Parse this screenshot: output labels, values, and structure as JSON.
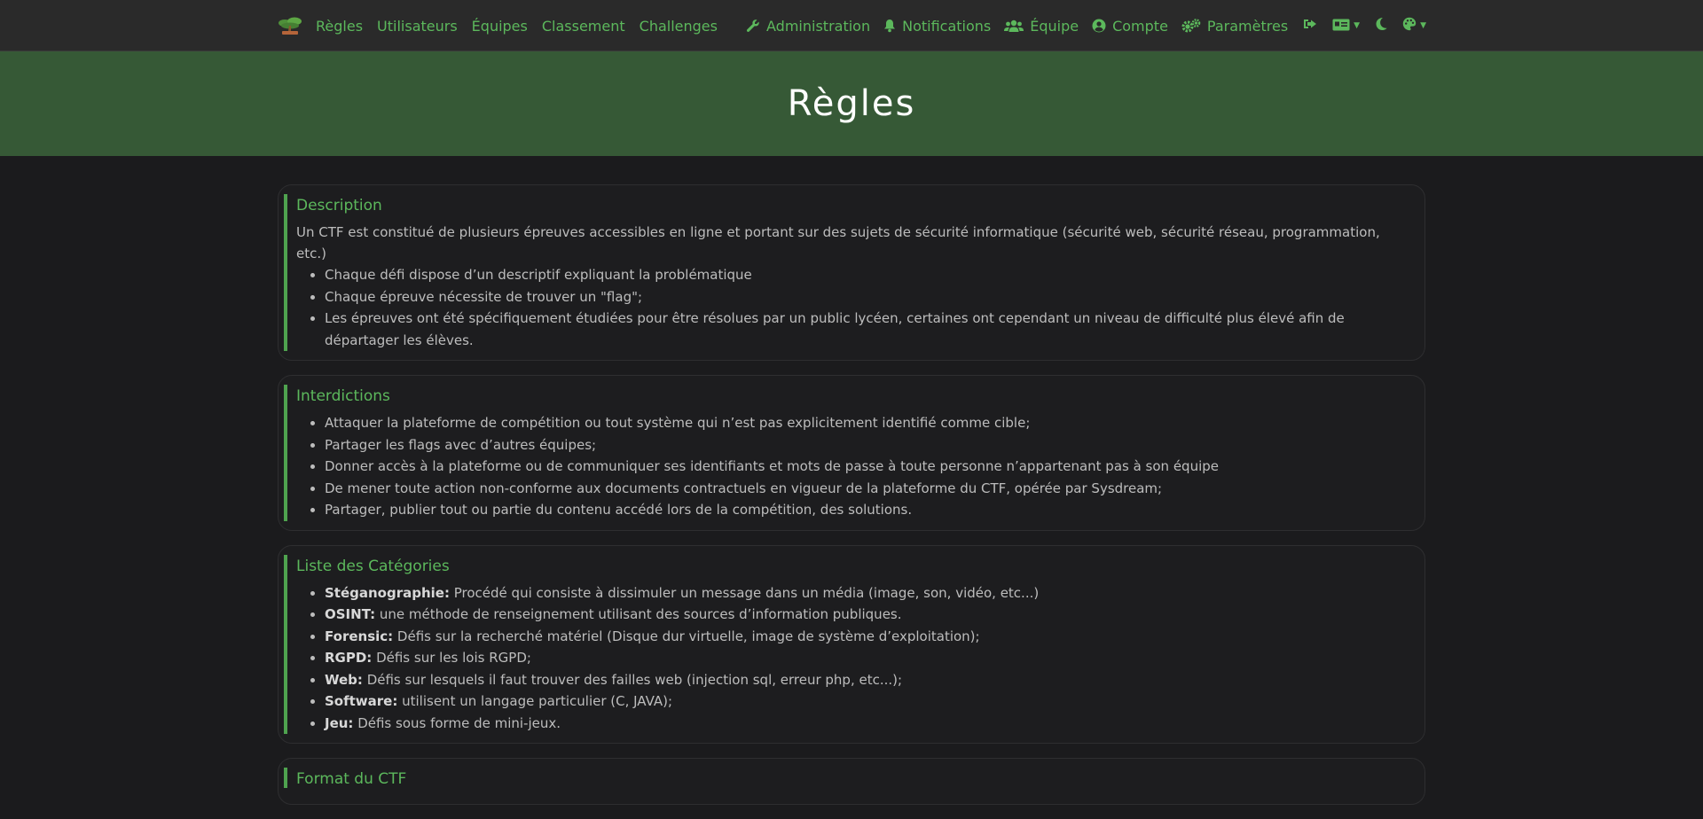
{
  "nav": {
    "brand_icon": "bonsai-tree-logo",
    "left": [
      {
        "label": "Règles",
        "name": "nav-regles"
      },
      {
        "label": "Utilisateurs",
        "name": "nav-utilisateurs"
      },
      {
        "label": "Équipes",
        "name": "nav-equipes"
      },
      {
        "label": "Classement",
        "name": "nav-classement"
      },
      {
        "label": "Challenges",
        "name": "nav-challenges"
      }
    ],
    "right": {
      "administration": "Administration",
      "notifications": "Notifications",
      "equipe": "Équipe",
      "compte": "Compte",
      "parametres": "Paramètres"
    }
  },
  "page": {
    "title": "Règles"
  },
  "sections": {
    "description": {
      "title": "Description",
      "text": "Un CTF est constitué de plusieurs épreuves accessibles en ligne et portant sur des sujets de sécurité informatique (sécurité web, sécurité réseau, programmation, etc.)",
      "items": [
        "Chaque défi dispose d’un descriptif expliquant la problématique",
        "Chaque épreuve nécessite de trouver un \"flag\";",
        "Les épreuves ont été spécifiquement étudiées pour être résolues par un public lycéen, certaines ont cependant un niveau de difficulté plus élevé afin de départager les élèves."
      ]
    },
    "interdictions": {
      "title": "Interdictions",
      "items": [
        "Attaquer la plateforme de compétition ou tout système qui n’est pas explicitement identifié comme cible;",
        "Partager les flags avec d’autres équipes;",
        "Donner accès à la plateforme ou de communiquer ses identifiants et mots de passe à toute personne n’appartenant pas à son équipe",
        "De mener toute action non-conforme aux documents contractuels en vigueur de la plateforme du CTF, opérée par Sysdream;",
        "Partager, publier tout ou partie du contenu accédé lors de la compétition, des solutions."
      ]
    },
    "categories": {
      "title": "Liste des Catégories",
      "items": [
        {
          "name": "Stéganographie:",
          "text": " Procédé qui consiste à dissimuler un message dans un média (image, son, vidéo, etc...)"
        },
        {
          "name": "OSINT:",
          "text": " une méthode de renseignement utilisant des sources d’information publiques."
        },
        {
          "name": "Forensic:",
          "text": " Défis sur la recherché matériel (Disque dur virtuelle, image de système d’exploitation);"
        },
        {
          "name": "RGPD:",
          "text": " Défis sur les lois RGPD;"
        },
        {
          "name": "Web:",
          "text": " Défis sur lesquels il faut trouver des failles web (injection sql, erreur php, etc...);"
        },
        {
          "name": "Software:",
          "text": " utilisent un langage particulier (C, JAVA);"
        },
        {
          "name": "Jeu:",
          "text": " Défis sous forme de mini-jeux."
        }
      ]
    },
    "format": {
      "title": "Format du CTF"
    }
  },
  "colors": {
    "accent": "#5cb85c",
    "navbar_bg": "#2a2a2a",
    "jumbotron_bg": "#365936",
    "page_bg": "#1b1b1d"
  }
}
